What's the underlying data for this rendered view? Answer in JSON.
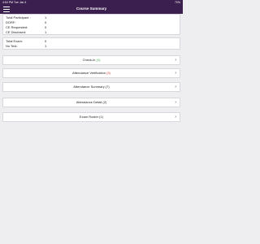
{
  "status_bar": {
    "time": "4:54 PM   Tue Jan 4",
    "battery": "70%"
  },
  "header": {
    "title": "Course Summary",
    "menu_icon": "hamburger-menu-icon"
  },
  "participants": [
    {
      "label": "Total Participant :",
      "value": "1"
    },
    {
      "label": "DORF:",
      "value": "0"
    },
    {
      "label": "CE Requested:",
      "value": "0"
    },
    {
      "label": "CE Disclosed:",
      "value": "1"
    }
  ],
  "exams": [
    {
      "label": "Total Exam:",
      "value": "0"
    },
    {
      "label": "No Test:",
      "value": "1"
    }
  ],
  "nav_rows": [
    {
      "label": "Check-in",
      "count": "(1)",
      "count_color": "#2e9e3e"
    },
    {
      "label": "Attendance Verification",
      "count": "(3)",
      "count_color": "#c0392b"
    },
    {
      "label": "Attendance Summary",
      "count": "(7)",
      "count_color": "#222222"
    },
    {
      "label": "Attendance Detail",
      "count": "(2)",
      "count_color": "#222222"
    },
    {
      "label": "Exam Roster",
      "count": "(1)",
      "count_color": "#222222"
    }
  ],
  "chevron_glyph": "›"
}
